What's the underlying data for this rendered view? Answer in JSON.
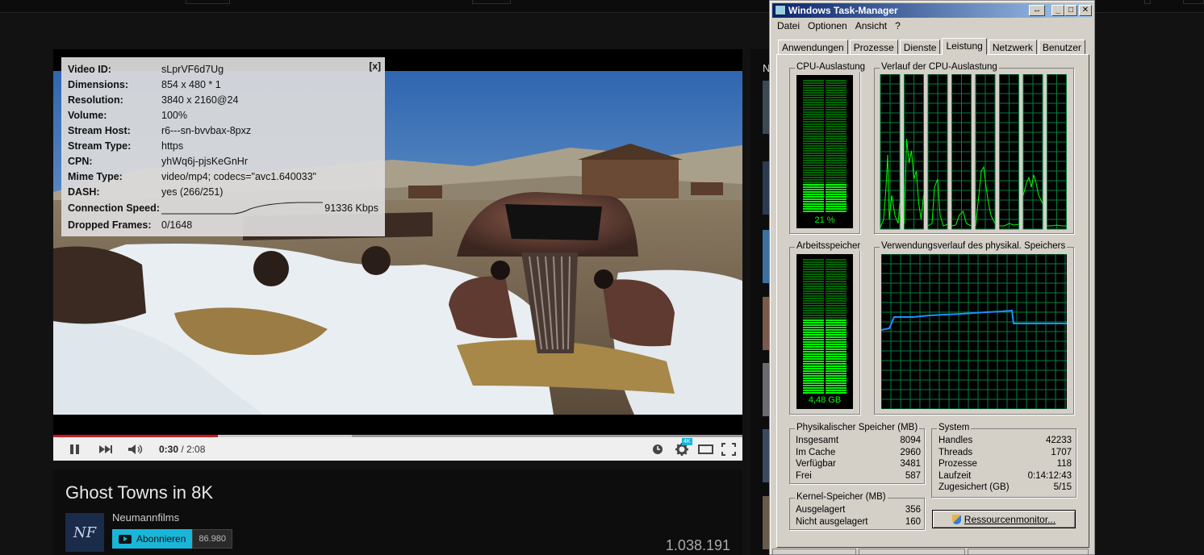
{
  "stats": {
    "close": "[x]",
    "rows": [
      {
        "k": "Video ID:",
        "v": "sLprVF6d7Ug"
      },
      {
        "k": "Dimensions:",
        "v": "854 x 480 * 1"
      },
      {
        "k": "Resolution:",
        "v": "3840 x 2160@24"
      },
      {
        "k": "Volume:",
        "v": "100%"
      },
      {
        "k": "Stream Host:",
        "v": "r6---sn-bvvbax-8pxz"
      },
      {
        "k": "Stream Type:",
        "v": "https"
      },
      {
        "k": "CPN:",
        "v": "yhWq6j-pjsKeGnHr"
      },
      {
        "k": "Mime Type:",
        "v": "video/mp4; codecs=\"avc1.640033\""
      },
      {
        "k": "DASH:",
        "v": "yes (266/251)"
      },
      {
        "k": "Connection Speed:",
        "v": "91336 Kbps"
      },
      {
        "k": "Dropped Frames:",
        "v": "0/1648"
      }
    ]
  },
  "player": {
    "current_time": "0:30",
    "duration": "/ 2:08",
    "quality_badge": "4K",
    "progress_fraction": 0.239,
    "buffer_fraction": 0.433
  },
  "video_info": {
    "title": "Ghost Towns in 8K",
    "channel": "Neumannfilms",
    "avatar_text": "NF",
    "subscribe_label": "Abonnieren",
    "subscriber_count": "86.980",
    "views": "1.038.191"
  },
  "sidebar": {
    "header_letter": "N"
  },
  "taskmanager": {
    "title": "Windows Task-Manager",
    "menu": [
      "Datei",
      "Optionen",
      "Ansicht",
      "?"
    ],
    "tabs": [
      "Anwendungen",
      "Prozesse",
      "Dienste",
      "Leistung",
      "Netzwerk",
      "Benutzer"
    ],
    "active_tab": "Leistung",
    "cpu_usage_label": "CPU-Auslastung",
    "cpu_usage_value": "21 %",
    "cpu_usage_fraction": 0.21,
    "cpu_history_label": "Verlauf der CPU-Auslastung",
    "mem_label": "Arbeitsspeicher",
    "mem_value": "4,48 GB",
    "mem_fraction": 0.55,
    "mem_history_label": "Verwendungsverlauf des physikal. Speichers",
    "physical": {
      "label": "Physikalischer Speicher (MB)",
      "rows": [
        {
          "k": "Insgesamt",
          "v": "8094"
        },
        {
          "k": "Im Cache",
          "v": "2960"
        },
        {
          "k": "Verfügbar",
          "v": "3481"
        },
        {
          "k": "Frei",
          "v": "587"
        }
      ]
    },
    "system": {
      "label": "System",
      "rows": [
        {
          "k": "Handles",
          "v": "42233"
        },
        {
          "k": "Threads",
          "v": "1707"
        },
        {
          "k": "Prozesse",
          "v": "118"
        },
        {
          "k": "Laufzeit",
          "v": "0:14:12:43"
        },
        {
          "k": "Zugesichert (GB)",
          "v": "5/15"
        }
      ]
    },
    "kernel": {
      "label": "Kernel-Speicher (MB)",
      "rows": [
        {
          "k": "Ausgelagert",
          "v": "356"
        },
        {
          "k": "Nicht ausgelagert",
          "v": "160"
        }
      ]
    },
    "resource_button": "Ressourcenmonitor..."
  },
  "colors": {
    "graph_green": "#00ff00",
    "grid_green": "#008040",
    "mem_line": "#1e90ff",
    "progress_red": "#cc181e",
    "subscribe": "#1ab6d9",
    "titlebar": "#0a246a"
  }
}
